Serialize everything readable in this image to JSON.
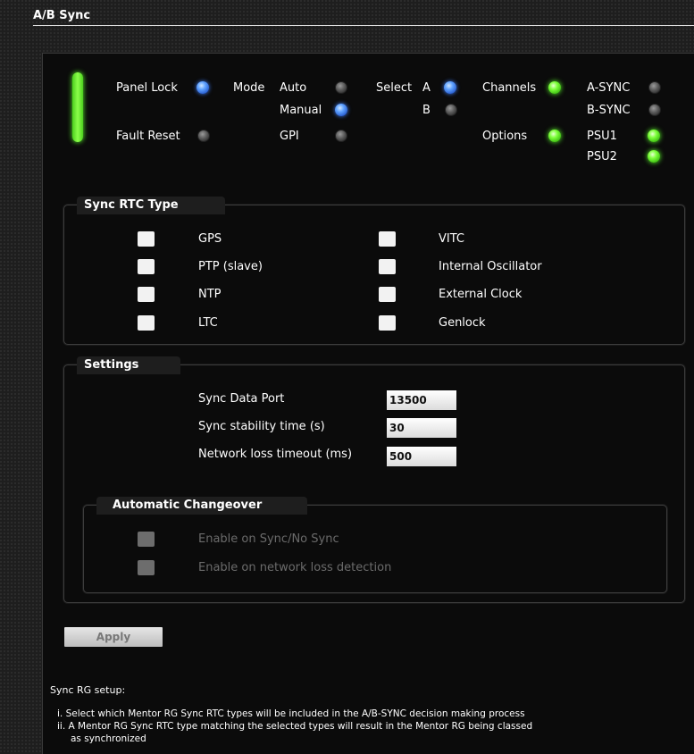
{
  "title": "A/B Sync",
  "status": {
    "panel_lock": "Panel Lock",
    "fault_reset": "Fault Reset",
    "mode": "Mode",
    "mode_auto": "Auto",
    "mode_manual": "Manual",
    "mode_gpi": "GPI",
    "select": "Select",
    "select_a": "A",
    "select_b": "B",
    "channels": "Channels",
    "options": "Options",
    "a_sync": "A-SYNC",
    "b_sync": "B-SYNC",
    "psu1": "PSU1",
    "psu2": "PSU2",
    "led_colors": {
      "active_blue": "#5fa2ff",
      "ok_green": "#7dff3a",
      "off_grey": "#5b5b5b"
    }
  },
  "sync_rtc_type": {
    "legend": "Sync RTC Type",
    "left": [
      "GPS",
      "PTP (slave)",
      "NTP",
      "LTC"
    ],
    "right": [
      "VITC",
      "Internal Oscillator",
      "External Clock",
      "Genlock"
    ]
  },
  "settings": {
    "legend": "Settings",
    "sync_data_port_label": "Sync Data Port",
    "sync_data_port_value": "13500",
    "stability_label": "Sync stability time (s)",
    "stability_value": "30",
    "network_loss_label": "Network loss timeout (ms)",
    "network_loss_value": "500",
    "auto_changeover": {
      "legend": "Automatic Changeover",
      "enable_sync": "Enable on Sync/No Sync",
      "enable_network": "Enable on network loss detection"
    }
  },
  "apply_label": "Apply",
  "notes": {
    "heading": "Sync RG setup:",
    "line1": "i. Select which Mentor RG Sync RTC types will be included in the A/B-SYNC decision making process",
    "line2": "ii. A Mentor RG Sync RTC type matching the selected types will result in the Mentor RG being classed",
    "line3": "as synchronized"
  }
}
